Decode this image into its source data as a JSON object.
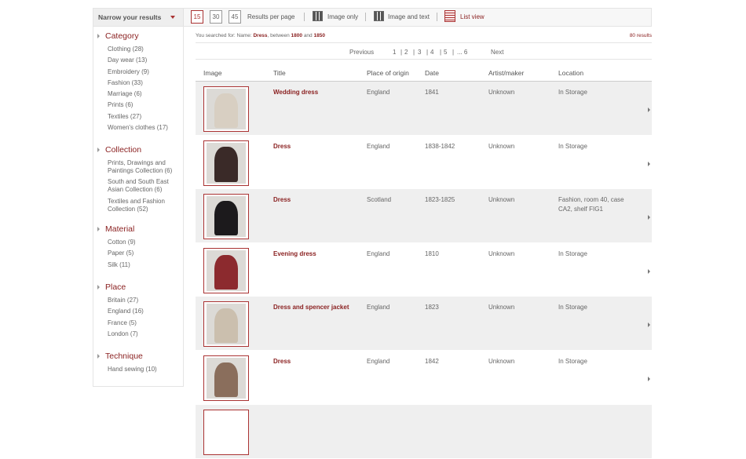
{
  "toolbar": {
    "narrow_label": "Narrow your results",
    "per_page": [
      "15",
      "30",
      "45"
    ],
    "per_page_active": "15",
    "per_page_label": "Results per page",
    "image_only": "Image only",
    "image_and_text": "Image and text",
    "list_view": "List view"
  },
  "sidebar": {
    "sections": [
      {
        "title": "Category",
        "items": [
          "Clothing (28)",
          "Day wear (13)",
          "Embroidery (9)",
          "Fashion (33)",
          "Marriage (6)",
          "Prints (6)",
          "Textiles (27)",
          "Women's clothes (17)"
        ]
      },
      {
        "title": "Collection",
        "items": [
          "Prints, Drawings and Paintings Collection (6)",
          "South and South East Asian Collection (6)",
          "Textiles and Fashion Collection (52)"
        ]
      },
      {
        "title": "Material",
        "items": [
          "Cotton (9)",
          "Paper (5)",
          "Silk (11)"
        ]
      },
      {
        "title": "Place",
        "items": [
          "Britain (27)",
          "England (16)",
          "France (5)",
          "London (7)"
        ]
      },
      {
        "title": "Technique",
        "items": [
          "Hand sewing (10)"
        ]
      }
    ]
  },
  "search": {
    "prefix": "You searched for: Name: ",
    "term": "Dress",
    "mid": ", between ",
    "from": "1800",
    "and": " and ",
    "to": "1850",
    "results": "80 results"
  },
  "pager": {
    "previous": "Previous",
    "pages": [
      "1",
      "|",
      "2",
      "|",
      "3",
      "|",
      "4",
      "|",
      "5",
      "|",
      "... 6"
    ],
    "next": "Next"
  },
  "table": {
    "headers": [
      "Image",
      "Title",
      "Place of origin",
      "Date",
      "Artist/maker",
      "Location"
    ],
    "rows": [
      {
        "title": "Wedding dress",
        "place": "England",
        "date": "1841",
        "artist": "Unknown",
        "location": "In Storage",
        "color": "#d8cfc2"
      },
      {
        "title": "Dress",
        "place": "England",
        "date": "1838-1842",
        "artist": "Unknown",
        "location": "In Storage",
        "color": "#3a2a28"
      },
      {
        "title": "Dress",
        "place": "Scotland",
        "date": "1823-1825",
        "artist": "Unknown",
        "location": "Fashion, room 40, case CA2, shelf FIG1",
        "color": "#1c1a1c"
      },
      {
        "title": "Evening dress",
        "place": "England",
        "date": "1810",
        "artist": "Unknown",
        "location": "In Storage",
        "color": "#8c2a2e"
      },
      {
        "title": "Dress and spencer jacket",
        "place": "England",
        "date": "1823",
        "artist": "Unknown",
        "location": "In Storage",
        "color": "#cbbfae"
      },
      {
        "title": "Dress",
        "place": "England",
        "date": "1842",
        "artist": "Unknown",
        "location": "In Storage",
        "color": "#8a6e5c"
      }
    ]
  }
}
